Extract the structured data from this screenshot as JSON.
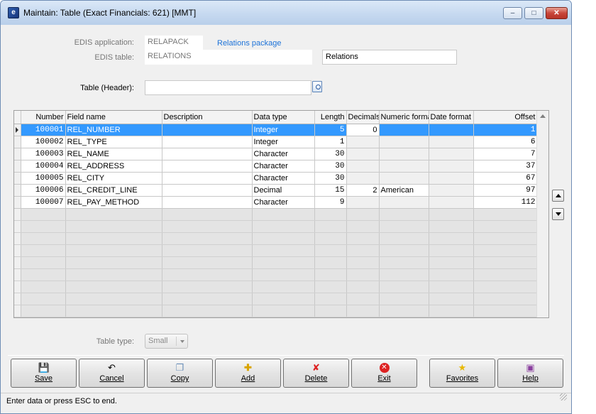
{
  "window": {
    "title": "Maintain: Table (Exact Financials: 621) [MMT]",
    "app_icon": "exact-app-icon",
    "controls": {
      "minimize": "minimize-icon",
      "maximize": "maximize-icon",
      "close": "close-icon"
    }
  },
  "form": {
    "edis_application_label": "EDIS application:",
    "edis_application_value": "RELAPACK",
    "edis_application_link": "Relations package",
    "edis_table_label": "EDIS table:",
    "edis_table_value": "RELATIONS",
    "edis_table_description": "Relations",
    "table_header_label": "Table (Header):",
    "table_header_value": "",
    "table_type_label": "Table type:",
    "table_type_value": "Small"
  },
  "grid": {
    "columns": [
      "Number",
      "Field name",
      "Description",
      "Data type",
      "Length",
      "Decimals",
      "Numeric forma",
      "Date format",
      "Offset"
    ],
    "rows": [
      {
        "number": "100001",
        "field_name": "REL_NUMBER",
        "description": "",
        "data_type": "Integer",
        "length": "5",
        "decimals": "0",
        "numeric_format": "",
        "date_format": "",
        "offset": "1",
        "selected": true
      },
      {
        "number": "100002",
        "field_name": "REL_TYPE",
        "description": "",
        "data_type": "Integer",
        "length": "1",
        "decimals": "",
        "numeric_format": "",
        "date_format": "",
        "offset": "6"
      },
      {
        "number": "100003",
        "field_name": "REL_NAME",
        "description": "",
        "data_type": "Character",
        "length": "30",
        "decimals": "",
        "numeric_format": "",
        "date_format": "",
        "offset": "7"
      },
      {
        "number": "100004",
        "field_name": "REL_ADDRESS",
        "description": "",
        "data_type": "Character",
        "length": "30",
        "decimals": "",
        "numeric_format": "",
        "date_format": "",
        "offset": "37"
      },
      {
        "number": "100005",
        "field_name": "REL_CITY",
        "description": "",
        "data_type": "Character",
        "length": "30",
        "decimals": "",
        "numeric_format": "",
        "date_format": "",
        "offset": "67"
      },
      {
        "number": "100006",
        "field_name": "REL_CREDIT_LINE",
        "description": "",
        "data_type": "Decimal",
        "length": "15",
        "decimals": "2",
        "numeric_format": "American",
        "date_format": "",
        "offset": "97"
      },
      {
        "number": "100007",
        "field_name": "REL_PAY_METHOD",
        "description": "",
        "data_type": "Character",
        "length": "9",
        "decimals": "",
        "numeric_format": "",
        "date_format": "",
        "offset": "112"
      }
    ],
    "empty_rows": 9
  },
  "buttons": [
    {
      "label": "Save",
      "icon": "save-icon"
    },
    {
      "label": "Cancel",
      "icon": "undo-icon"
    },
    {
      "label": "Copy",
      "icon": "copy-icon"
    },
    {
      "label": "Add",
      "icon": "add-icon"
    },
    {
      "label": "Delete",
      "icon": "delete-icon"
    },
    {
      "label": "Exit",
      "icon": "exit-icon"
    },
    {
      "label": "Favorites",
      "icon": "star-icon"
    },
    {
      "label": "Help",
      "icon": "help-book-icon"
    }
  ],
  "status": {
    "text": "Enter data or press ESC to end."
  }
}
